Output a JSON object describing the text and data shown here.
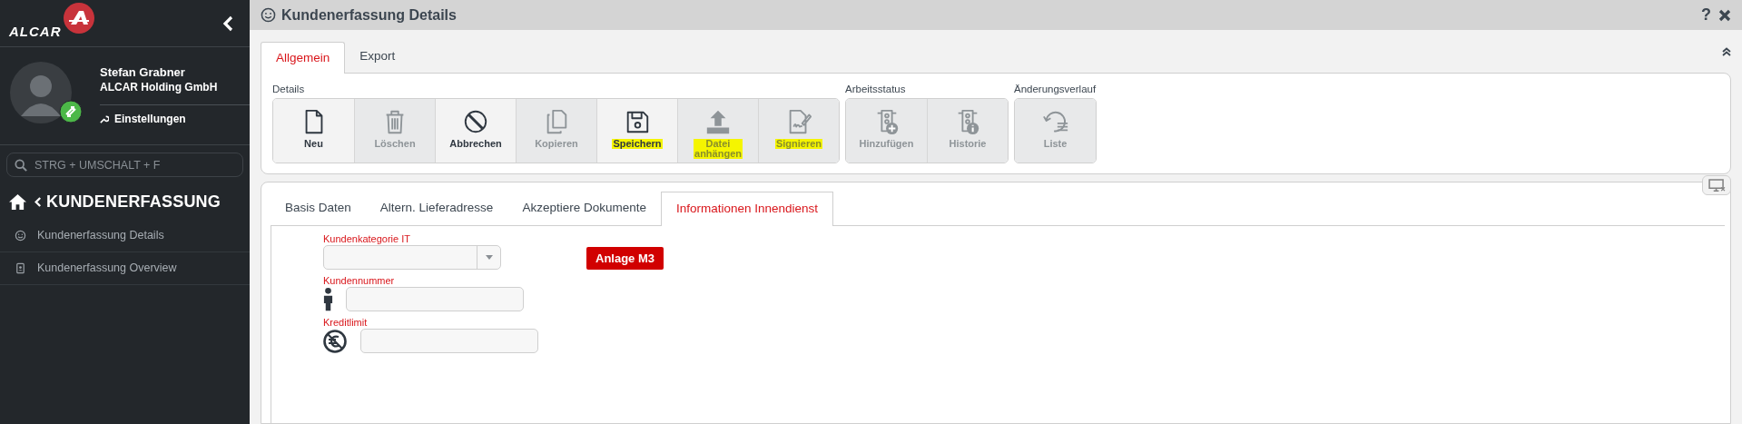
{
  "sidebar": {
    "logo_text": "ALCAR",
    "user": {
      "name": "Stefan Grabner",
      "company": "ALCAR Holding GmbH",
      "settings_link": "Einstellungen"
    },
    "search": {
      "placeholder": "STRG + UMSCHALT + F"
    },
    "section_title": "KUNDENERFASSUNG",
    "items": [
      {
        "label": "Kundenerfassung Details",
        "selected": false
      },
      {
        "label": "Kundenerfassung Overview",
        "selected": false
      }
    ]
  },
  "window": {
    "title": "Kundenerfassung Details",
    "help": "?"
  },
  "ribbon": {
    "tabs": [
      {
        "label": "Allgemein",
        "selected": true
      },
      {
        "label": "Export",
        "selected": false
      }
    ],
    "groups": [
      {
        "label": "Details",
        "buttons": [
          {
            "label": "Neu",
            "disabled": false,
            "highlighted": false
          },
          {
            "label": "Löschen",
            "disabled": true,
            "highlighted": false
          },
          {
            "label": "Abbrechen",
            "disabled": false,
            "highlighted": false
          },
          {
            "label": "Kopieren",
            "disabled": true,
            "highlighted": false
          },
          {
            "label": "Speichern",
            "disabled": false,
            "highlighted": true
          },
          {
            "label": "Datei\nanhängen",
            "disabled": true,
            "highlighted": true
          },
          {
            "label": "Signieren",
            "disabled": true,
            "highlighted": true
          }
        ]
      },
      {
        "label": "Arbeitsstatus",
        "buttons": [
          {
            "label": "Hinzufügen",
            "disabled": true,
            "highlighted": false
          },
          {
            "label": "Historie",
            "disabled": true,
            "highlighted": false
          }
        ]
      },
      {
        "label": "Änderungsverlauf",
        "buttons": [
          {
            "label": "Liste",
            "disabled": true,
            "highlighted": false
          }
        ]
      }
    ]
  },
  "form": {
    "tabs": [
      {
        "label": "Basis Daten",
        "selected": false
      },
      {
        "label": "Altern. Lieferadresse",
        "selected": false
      },
      {
        "label": "Akzeptiere Dokumente",
        "selected": false
      },
      {
        "label": "Informationen Innendienst",
        "selected": true
      }
    ],
    "fields": [
      {
        "kind": "select",
        "label": "Kundenkategorie IT"
      },
      {
        "kind": "text",
        "label": "Kundennummer"
      },
      {
        "kind": "text",
        "label": "Kreditlimit"
      }
    ],
    "action_button": "Anlage M3"
  }
}
